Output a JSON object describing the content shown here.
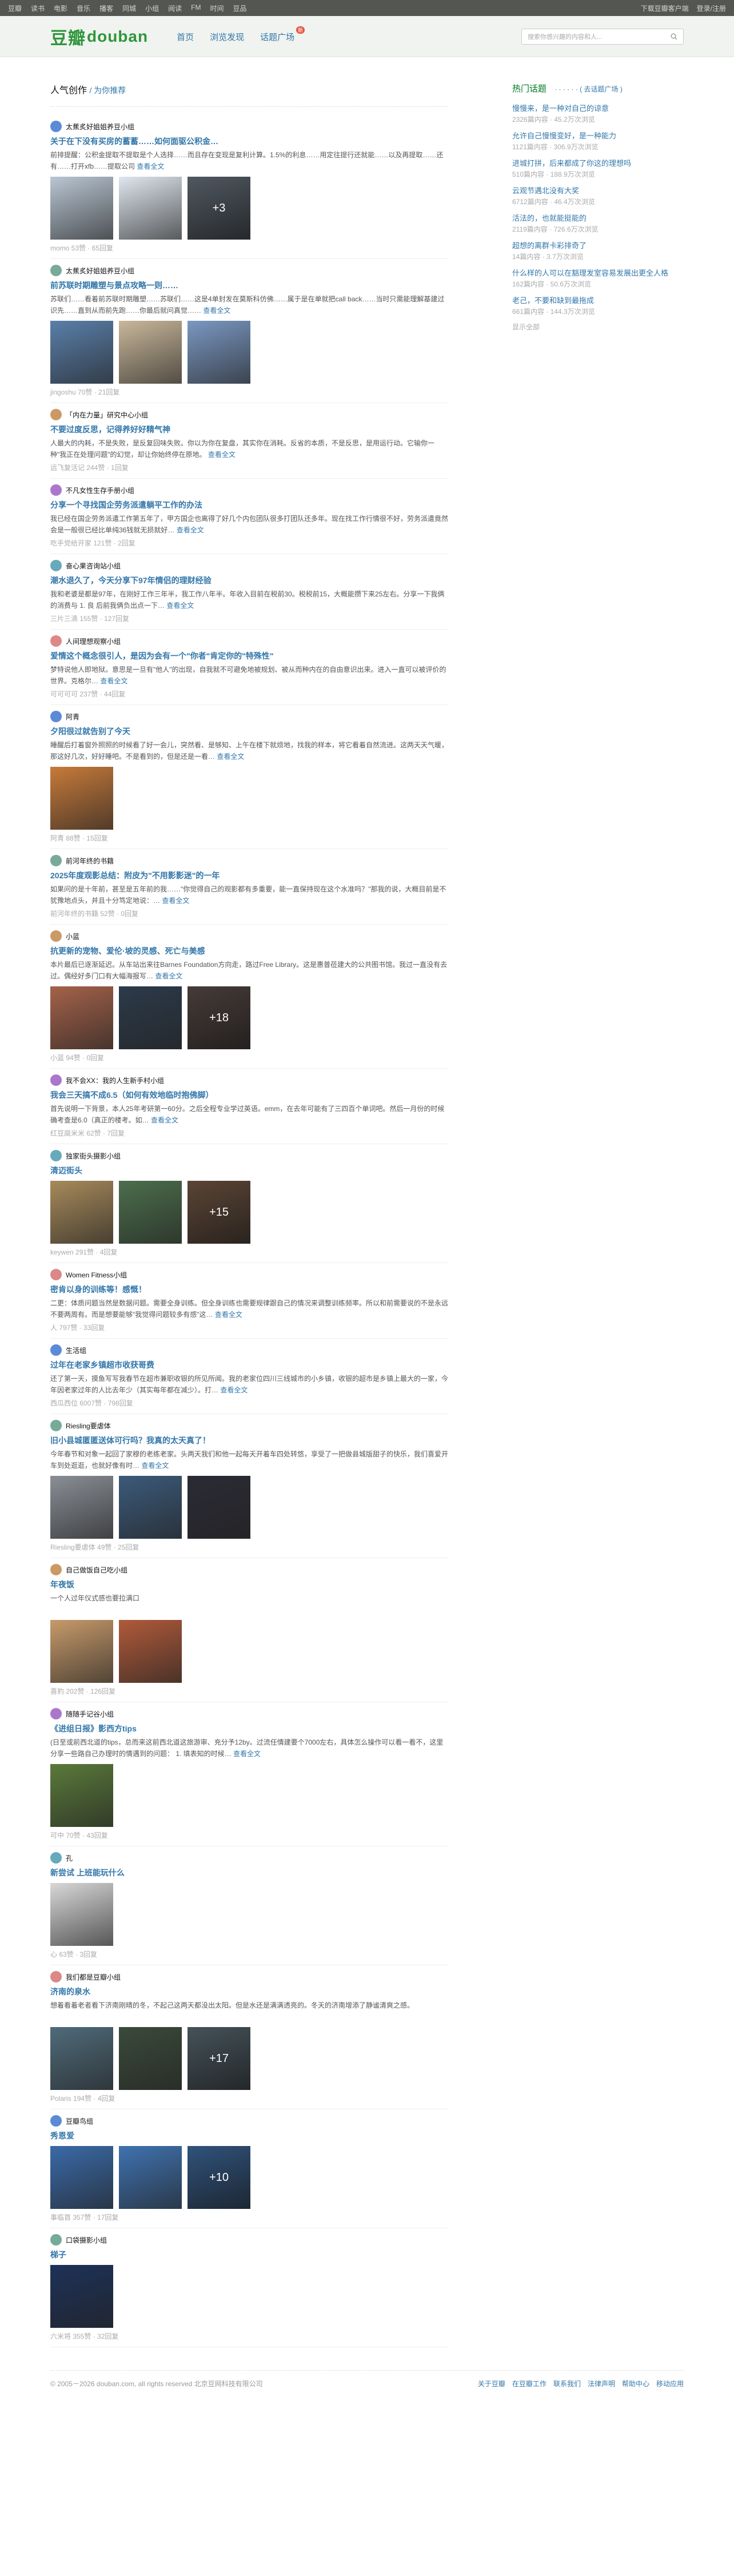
{
  "topbar": {
    "nav": [
      "豆瓣",
      "读书",
      "电影",
      "音乐",
      "播客",
      "同城",
      "小组",
      "阅读",
      "FM",
      "时间",
      "豆品"
    ],
    "right": [
      "下载豆瓣客户端",
      "登录/注册"
    ]
  },
  "header": {
    "logo_cn": "豆瓣",
    "logo_en": "douban",
    "nav": [
      "首页",
      "浏览发现",
      "话题广场"
    ],
    "badge": "新",
    "search_placeholder": "搜索你感兴趣的内容和人..."
  },
  "page": {
    "title": "人气创作",
    "sub": "为你推荐"
  },
  "feed": [
    {
      "group": "太蕉炙好姐姐养豆小组",
      "title": "关于在下没有买房的蓄蓄……如何面驱公积金…",
      "summary": "前排提醒：公积金提取不提取是个人选择……而且存在变现是复利计算。1.5%的利息……用定往提行还就能……以及再提取……还有……打开xfb……提取公司",
      "more": "查看全文",
      "images": 3,
      "more_count": "+3",
      "meta": "momo 53赞 · 65回复",
      "tint": [
        "#b9c6d3",
        "#dfe6ee",
        "#7b8795"
      ]
    },
    {
      "group": "太蕉炙好姐姐养豆小组",
      "title": "前苏联时期雕塑与景点攻略一则……",
      "summary": "苏联们……看着前苏联时期雕塑……苏联们……这是4单封发在莫斯科仿佛……属于是在单就把call back……当时只需能理解基建过识先……直到从而前先跑……你最后就问真觉……",
      "more": "查看全文",
      "images": 3,
      "more_count": "",
      "meta": "jingoshu 70赞 · 21回复",
      "tint": [
        "#5a7faa",
        "#c9b79a",
        "#7a98c2"
      ]
    },
    {
      "group": "「内在力量」研究中心小组",
      "title": "不要过度反思，记得养好好精气神",
      "summary": "人最大的内耗，不是失败，是反复回味失败。你以为你在复盘，其实你在消耗。反省的本质，不是反思，是用运行动。它输你一种\"我正在处理问题\"的幻觉，却让你始终停在原地。",
      "more": "查看全文",
      "images": 0,
      "more_count": "",
      "meta": "远飞复活记 244赞 · 1回复",
      "tint": []
    },
    {
      "group": "不凡女性生存手册小组",
      "title": "分享一个寻找国企劳务派遣躺平工作的办法",
      "summary": "我已经在国企劳务派遣工作第五年了，甲方国企也离得了好几个内包团队很多打团队还多年。现在找工作行情很不好，劳务派遣竟然会是一般很已经比单纯36钱就无损就好…",
      "more": "查看全文",
      "images": 0,
      "more_count": "",
      "meta": "吃手党给开家 121赞 · 2回复",
      "tint": []
    },
    {
      "group": "奋心果咨询站小组",
      "title": "潮水退久了，今天分享下97年情侣的理财经验",
      "summary": "我和老婆是都是97年，在刚好工作三年半，我工作八年半。年收入目前在税前30。税税前15，大概能攒下来25左右。分享一下我俩的消费与 1. 良 后前我俩负出点一下…",
      "more": "查看全文",
      "images": 0,
      "more_count": "",
      "meta": "三片三滴 155赞 · 127回复",
      "tint": []
    },
    {
      "group": "人间理想观察小组",
      "title": "爱情这个概念很引人，是因为会有一个\"你者\"肯定你的\"特殊性\"",
      "summary": "梦特说他人即地狱。意思是一旦有\"他人\"的出现，自我就不可避免地被规划、被从而种内在的自由意识出来。进入一直可以被评价的世界。克格尔…",
      "more": "查看全文",
      "images": 0,
      "more_count": "",
      "meta": "可可可可 237赞 · 44回复",
      "tint": []
    },
    {
      "group": "阿青",
      "title": "夕阳很过就告别了今天",
      "summary": "睡醒后打着窗外照照的时候看了好一会儿，突然看、是够知、上午在楼下就烦地，找我的样本，将它看着自然流进。这两天天气暖，那这好几次，好好睡吧。不是看到的，但是还是一看…",
      "more": "查看全文",
      "images": 1,
      "more_count": "",
      "meta": "阿青 88赞 · 15回复",
      "tint": [
        "#c77a3a"
      ]
    },
    {
      "group": "前河年终的书籍",
      "title": "2025年度观影总结：附皮为\"不用影影迷\"的一年",
      "summary": "如果问的是十年前，甚至是五年前的我……\"你觉得自己的观影都有多重要，能一直保持现在这个水准吗？\"那我的说，大概目前是不犹豫地点头，并且十分笃定地说：…",
      "more": "查看全文",
      "images": 0,
      "more_count": "",
      "meta": "前河年终的书籍 52赞 · 0回复",
      "tint": []
    },
    {
      "group": "小蓝",
      "title": "抗更新的宠物、爱伦·坡的灵感、死亡与美感",
      "summary": "本片最后已逐渐延迟。从车站出来往Barnes Foundation方向走，路过Free Library。这是惠普莅建大的公共图书馆。我过一直没有去过。偶经好多门口有大幅海报写…",
      "more": "查看全文",
      "images": 3,
      "more_count": "+18",
      "meta": "小蓝 94赞 · 0回复",
      "tint": [
        "#a5624a",
        "#2c3a4a",
        "#6c5b57"
      ]
    },
    {
      "group": "我不会XX：我的人生新手村小组",
      "title": "我会三天搞不成6.5（如何有效地临时抱佛脚）",
      "summary": "首先说明一下背景，本人25年考研第一60分。之后全程专业学过英语。emm，在去年可能有了三四百个单词吧。然后一月份的时候确考查是6.0（真正的楼考。如…",
      "more": "查看全文",
      "images": 0,
      "more_count": "",
      "meta": "红豆腐米米 62赞 · 7回复",
      "tint": []
    },
    {
      "group": "独家街头摄影小组",
      "title": "清迈街头",
      "summary": "",
      "more": "",
      "images": 3,
      "more_count": "+15",
      "meta": "keywen 291赞 · 4回复",
      "tint": [
        "#a78a5a",
        "#4c6e4c",
        "#8c6a52"
      ]
    },
    {
      "group": "Women Fitness小组",
      "title": "密肯以身的训练等！感慨！",
      "summary": "二更：体质问题当然是数据问题。需要全身训练。但全身训练也需要规律跟自己的情况来调整训练频率。所以和前需要说的不是永远不要两周有。而是想要能够\"我觉得问题较多有感\"这…",
      "more": "查看全文",
      "images": 0,
      "more_count": "",
      "meta": "人 797赞 · 33回复",
      "tint": []
    },
    {
      "group": "生活组",
      "title": "过年在老家乡镇超市收获哥费",
      "summary": "还了第一天，摸鱼写写我春节在超市兼职收银的所见所闻。我的老家位四川三线城市的小乡镇，收银的超市是乡镇上最大的一家，今年因老家过年的人比去年少（其实每年都在减少）。打…",
      "more": "查看全文",
      "images": 0,
      "more_count": "",
      "meta": "西瓜西位 6007赞 · 798回复",
      "tint": []
    },
    {
      "group": "Riesling要虐体",
      "title": "旧小县城匿匿送体可行吗？我真的太天真了！",
      "summary": "今年春节和对象一起回了家穆的老练老家。头两天我们和他一起每天开着车四处转悠，享受了一把做县城版甜子的快乐，我们喜爱开车到处逛逛，也就好像有时…",
      "more": "查看全文",
      "images": 3,
      "more_count": "",
      "meta": "Riesling要虐体 49赞 · 25回复",
      "tint": [
        "#8a8f96",
        "#3c5a7a",
        "#2b2b35"
      ]
    },
    {
      "group": "自己做饭自己吃小组",
      "title": "年夜饭",
      "summary": "一个人过年仪式感也要拉满口",
      "more": "",
      "images": 2,
      "more_count": "",
      "meta": "喜豹 202赞 · 126回复",
      "tint": [
        "#c79a6a",
        "#b05a3a"
      ]
    },
    {
      "group": "随随手记谷小组",
      "title": "《进组日报》影西方tips",
      "summary": "(日至或前西北道的tips，总而来这前西北道这旅游审、充分予12by。过流任情建要个7000左右，具体怎么操作可以看一看不，这里分享一些路自己办理时的情遇到的问题： 1. 填表知的时候…",
      "more": "查看全文",
      "images": 1,
      "more_count": "",
      "meta": "可中 70赞 · 43回复",
      "tint": [
        "#5a7a3a"
      ]
    },
    {
      "group": "孔",
      "title": "新尝试 上班能玩什么",
      "summary": "",
      "more": "",
      "images": 1,
      "more_count": "",
      "meta": "心 63赞 · 3回复",
      "tint": [
        "#d8d8d8"
      ]
    },
    {
      "group": "我们都是豆瓣小组",
      "title": "济南的泉水",
      "summary": "想着看着老者看下济南刚晴的冬，不起己这两天都没出太阳。但是水还是满满透亮的。冬天的济南增添了静谧清爽之感。",
      "more": "",
      "images": 3,
      "more_count": "+17",
      "meta": "Polaris 194赞 · 4回复",
      "tint": [
        "#4f6b7a",
        "#3a4a3a",
        "#6a7f8a"
      ]
    },
    {
      "group": "豆瓣鸟组",
      "title": "秀恩爱",
      "summary": "",
      "more": "",
      "images": 3,
      "more_count": "+10",
      "meta": "事临首 357赞 · 17回复",
      "tint": [
        "#3a6aa8",
        "#3f72b0",
        "#4a7fbe"
      ]
    },
    {
      "group": "口袋摄影小组",
      "title": "梯子",
      "summary": "",
      "more": "",
      "images": 1,
      "more_count": "",
      "meta": "六米将 355赞 · 32回复",
      "tint": [
        "#1d3158"
      ]
    }
  ],
  "aside": {
    "title": "热门话题",
    "sub": "去话题广场",
    "topics": [
      {
        "title": "慢慢来，是一种对自己的谅意",
        "meta": "2326篇内容 · 45.2万次浏览"
      },
      {
        "title": "允许自己慢慢变好，是一种能力",
        "meta": "1121篇内容 · 306.9万次浏览"
      },
      {
        "title": "进城打拼，后来都成了你这的理想吗",
        "meta": "510篇内容 · 188.9万次浏览"
      },
      {
        "title": "云观节遇北没有大奖",
        "meta": "6712篇内容 · 46.4万次浏览"
      },
      {
        "title": "活法的，也就能挺能的",
        "meta": "2119篇内容 · 726.6万次浏览"
      },
      {
        "title": "超想的离群卡彩排奇了",
        "meta": "14篇内容 · 3.7万次浏览"
      },
      {
        "title": "什么样的人可以在豁理发室容易发展出更全人格",
        "meta": "162篇内容 · 50.6万次浏览"
      },
      {
        "title": "老己，不要和缺到最拖成",
        "meta": "661篇内容 · 144.3万次浏览"
      }
    ],
    "more": "显示全部"
  },
  "footer": {
    "copy": "© 2005－2026 douban.com, all rights reserved 北京豆网科技有限公司",
    "links": [
      "关于豆瓣",
      "在豆瓣工作",
      "联系我们",
      "法律声明",
      "帮助中心",
      "移动应用"
    ]
  }
}
